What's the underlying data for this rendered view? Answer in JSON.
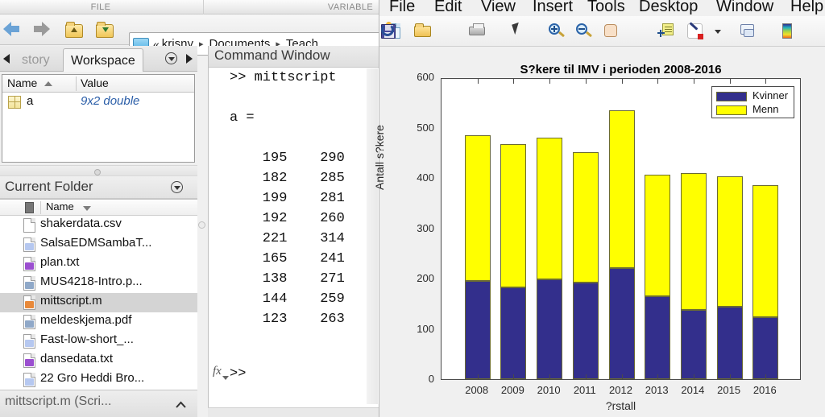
{
  "desktop": {
    "ribbon_sections": [
      "FILE",
      "VARIABLE"
    ],
    "nav": {
      "back_icon": "back-arrow-icon",
      "forward_icon": "forward-arrow-icon",
      "up_icon": "up-folder-icon",
      "browse_icon": "browse-folder-icon",
      "address_lead": "«",
      "breadcrumbs": [
        "krisny",
        "Documents",
        "Teach"
      ],
      "separator": "▸"
    },
    "tabs": [
      {
        "label": "story",
        "active": false
      },
      {
        "label": "Workspace",
        "active": true
      }
    ],
    "workspace": {
      "columns": [
        "Name",
        "Value"
      ],
      "sort_indicator": "ascending",
      "rows": [
        {
          "name": "a",
          "value": "9x2 double",
          "icon": "matrix-icon"
        }
      ]
    },
    "current_folder": {
      "title": "Current Folder",
      "columns": [
        "Name"
      ],
      "sort_indicator": "descending",
      "files": [
        {
          "name": "shakerdata.csv",
          "color": "#ffffff",
          "selected": false
        },
        {
          "name": "SalsaEDMSambaT...",
          "color": "#b6c8f0",
          "selected": false
        },
        {
          "name": "plan.txt",
          "color": "#9b4fd0",
          "selected": false
        },
        {
          "name": "MUS4218-Intro.p...",
          "color": "#8fa8c8",
          "selected": false
        },
        {
          "name": "mittscript.m",
          "color": "#e8893a",
          "selected": true
        },
        {
          "name": "meldeskjema.pdf",
          "color": "#8fa8c8",
          "selected": false
        },
        {
          "name": "Fast-low-short_...",
          "color": "#b6c8f0",
          "selected": false
        },
        {
          "name": "dansedata.txt",
          "color": "#9b4fd0",
          "selected": false
        },
        {
          "name": "22 Gro Heddi Bro...",
          "color": "#b6c8f0",
          "selected": false
        }
      ]
    },
    "status": {
      "text": "mittscript.m  (Scri...",
      "chevron_icon": "chevron-up-icon"
    }
  },
  "command_window": {
    "title": "Command Window",
    "output": ">> mittscript\n\na =\n\n    195    290\n    182    285\n    199    281\n    192    260\n    221    314\n    165    241\n    138    271\n    144    259\n    123    263",
    "prompt": ">>",
    "fx_label": "fx"
  },
  "figure": {
    "menus": [
      "File",
      "Edit",
      "View",
      "Insert",
      "Tools",
      "Desktop",
      "Window",
      "Help"
    ],
    "toolbar": [
      "new-figure-icon",
      "open-file-icon",
      "save-figure-icon",
      "print-figure-icon",
      "pointer-icon",
      "zoom-in-icon",
      "zoom-out-icon",
      "pan-icon",
      "rotate-3d-icon",
      "data-cursor-icon",
      "brush-data-icon",
      "brush-dropdown-icon",
      "link-plot-icon",
      "colorbar-icon"
    ]
  },
  "chart_data": {
    "type": "bar",
    "stacked": true,
    "title": "S?kere til IMV i perioden 2008-2016",
    "xlabel": "?rstall",
    "ylabel": "Antall s?kere",
    "categories": [
      "2008",
      "2009",
      "2010",
      "2011",
      "2012",
      "2013",
      "2014",
      "2015",
      "2016"
    ],
    "series": [
      {
        "name": "Kvinner",
        "color": "#332f8c",
        "values": [
          195,
          182,
          199,
          192,
          221,
          165,
          138,
          144,
          123
        ]
      },
      {
        "name": "Menn",
        "color": "#ffff00",
        "values": [
          290,
          285,
          281,
          260,
          314,
          241,
          271,
          259,
          263
        ]
      }
    ],
    "totals": [
      485,
      467,
      480,
      452,
      535,
      406,
      409,
      403,
      386
    ],
    "ylim": [
      0,
      600
    ],
    "yticks": [
      0,
      100,
      200,
      300,
      400,
      500,
      600
    ],
    "grid": false,
    "legend_position": "top-right"
  }
}
